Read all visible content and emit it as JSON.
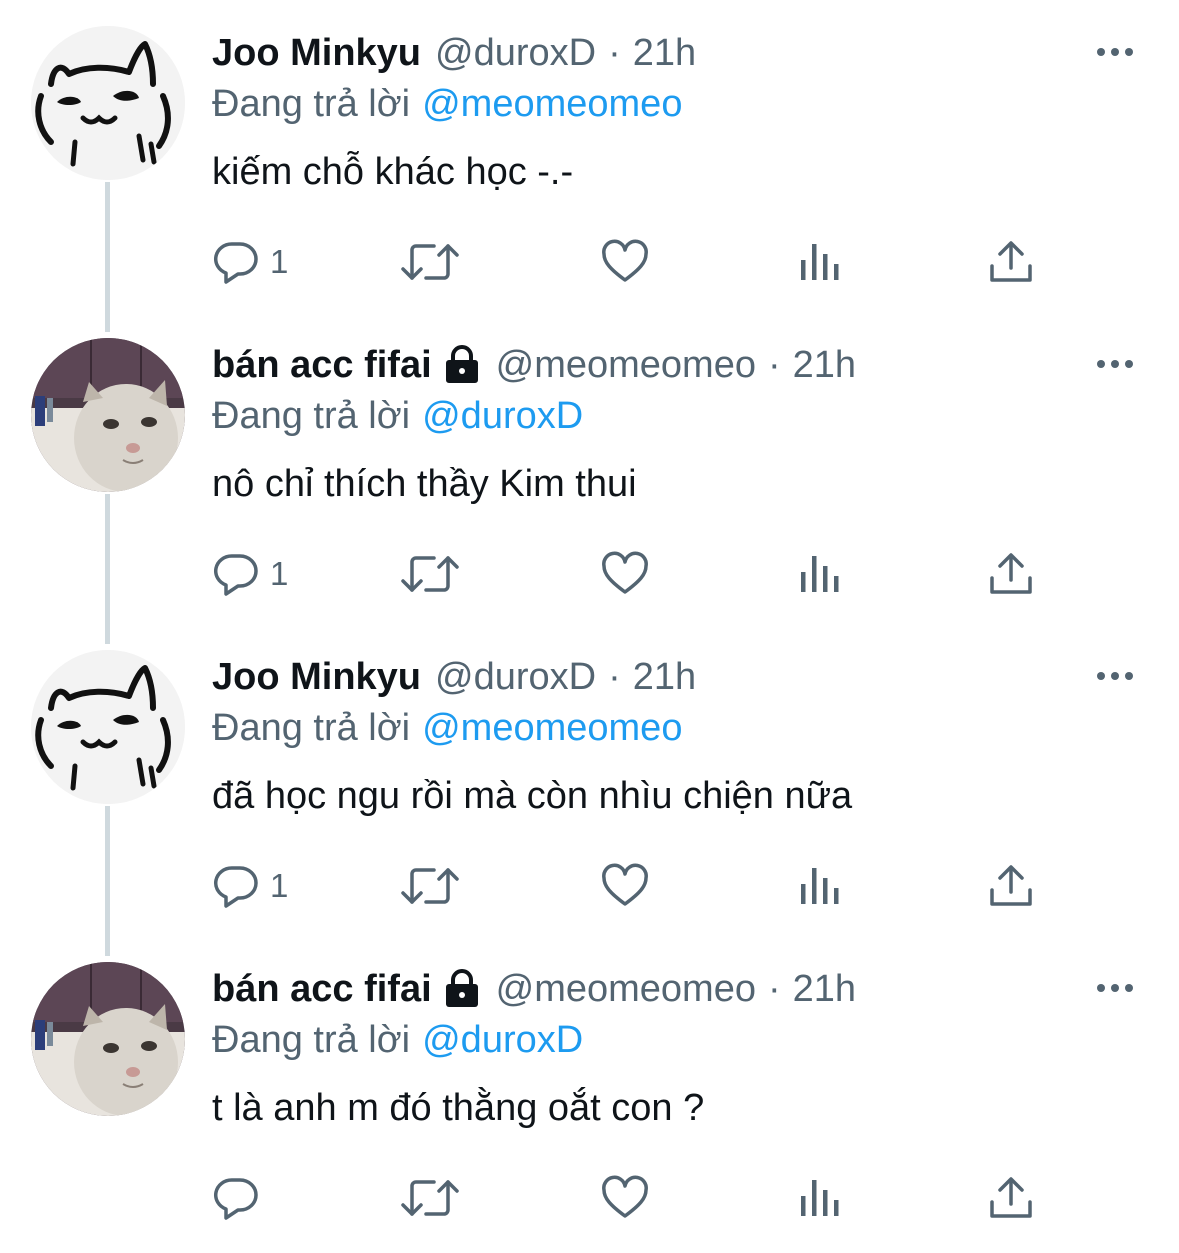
{
  "tweets": [
    {
      "avatar": "cat-doodle-avatar",
      "name": "Joo Minkyu",
      "locked": false,
      "handle": "@duroxD",
      "separator": "·",
      "time": "21h",
      "replying_label": "Đang trả lời",
      "replying_to": "@meomeomeo",
      "text": "kiếm chỗ khác học -.-",
      "reply_count": "1"
    },
    {
      "avatar": "cat-photo-avatar",
      "name": "bán acc fifai",
      "locked": true,
      "handle": "@meomeomeo",
      "separator": "·",
      "time": "21h",
      "replying_label": "Đang trả lời",
      "replying_to": "@duroxD",
      "text": "nô chỉ thích thầy Kim thui",
      "reply_count": "1"
    },
    {
      "avatar": "cat-doodle-avatar",
      "name": "Joo Minkyu",
      "locked": false,
      "handle": "@duroxD",
      "separator": "·",
      "time": "21h",
      "replying_label": "Đang trả lời",
      "replying_to": "@meomeomeo",
      "text": "đã học ngu rồi mà còn nhìu chiện nữa",
      "reply_count": "1"
    },
    {
      "avatar": "cat-photo-avatar",
      "name": "bán acc fifai",
      "locked": true,
      "handle": "@meomeomeo",
      "separator": "·",
      "time": "21h",
      "replying_label": "Đang trả lời",
      "replying_to": "@duroxD",
      "text": "t là anh m đó thằng oắt con ?",
      "reply_count": ""
    }
  ],
  "colors": {
    "text_primary": "#0f1419",
    "text_secondary": "#536471",
    "accent": "#1d9bf0",
    "thread_line": "#cfd9de"
  },
  "icons": {
    "reply": "comment-icon",
    "retweet": "retweet-icon",
    "like": "heart-icon",
    "views": "analytics-icon",
    "share": "share-icon",
    "more": "more-icon",
    "lock": "lock-icon"
  }
}
